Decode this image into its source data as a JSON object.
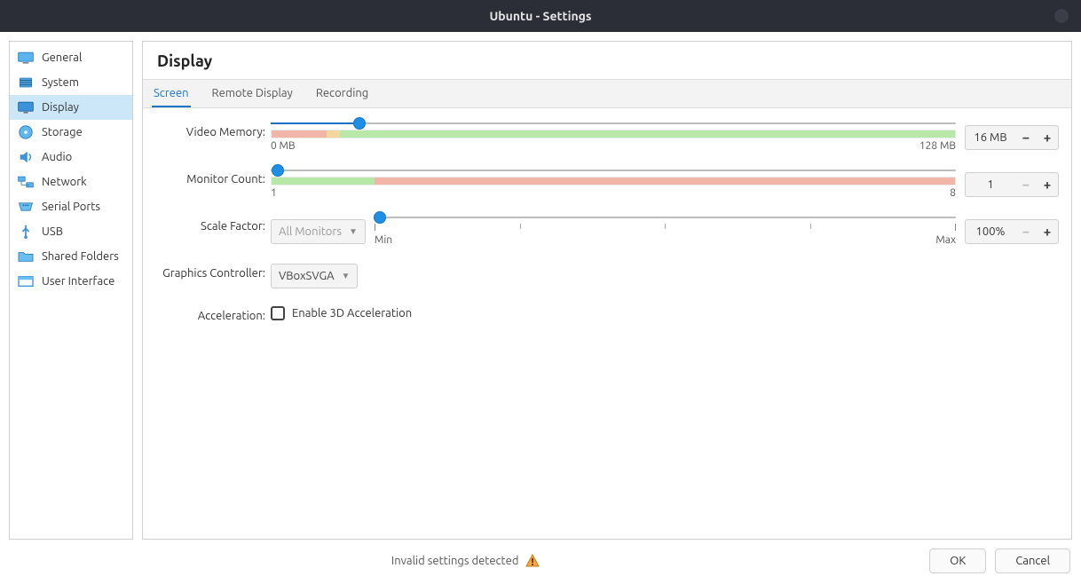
{
  "title": "Ubuntu - Settings",
  "sidebar": {
    "items": [
      {
        "label": "General"
      },
      {
        "label": "System"
      },
      {
        "label": "Display"
      },
      {
        "label": "Storage"
      },
      {
        "label": "Audio"
      },
      {
        "label": "Network"
      },
      {
        "label": "Serial Ports"
      },
      {
        "label": "USB"
      },
      {
        "label": "Shared Folders"
      },
      {
        "label": "User Interface"
      }
    ],
    "active_index": 2
  },
  "page": {
    "title": "Display",
    "tabs": {
      "items": [
        {
          "label": "Screen"
        },
        {
          "label": "Remote Display"
        },
        {
          "label": "Recording"
        }
      ],
      "active_index": 0
    }
  },
  "form": {
    "video_memory": {
      "label": "Video Memory:",
      "min_label": "0 MB",
      "max_label": "128 MB",
      "value": "16 MB",
      "percent": 13
    },
    "monitor_count": {
      "label": "Monitor Count:",
      "min_label": "1",
      "max_label": "8",
      "value": "1",
      "percent": 0
    },
    "scale_factor": {
      "label": "Scale Factor:",
      "selector": "All Monitors",
      "min_label": "Min",
      "max_label": "Max",
      "value": "100%",
      "percent": 0
    },
    "graphics_controller": {
      "label": "Graphics Controller:",
      "value": "VBoxSVGA"
    },
    "acceleration": {
      "label": "Acceleration:",
      "checkbox_label": "Enable 3D Acceleration",
      "checked": false
    }
  },
  "footer": {
    "status": "Invalid settings detected",
    "ok": "OK",
    "cancel": "Cancel"
  }
}
